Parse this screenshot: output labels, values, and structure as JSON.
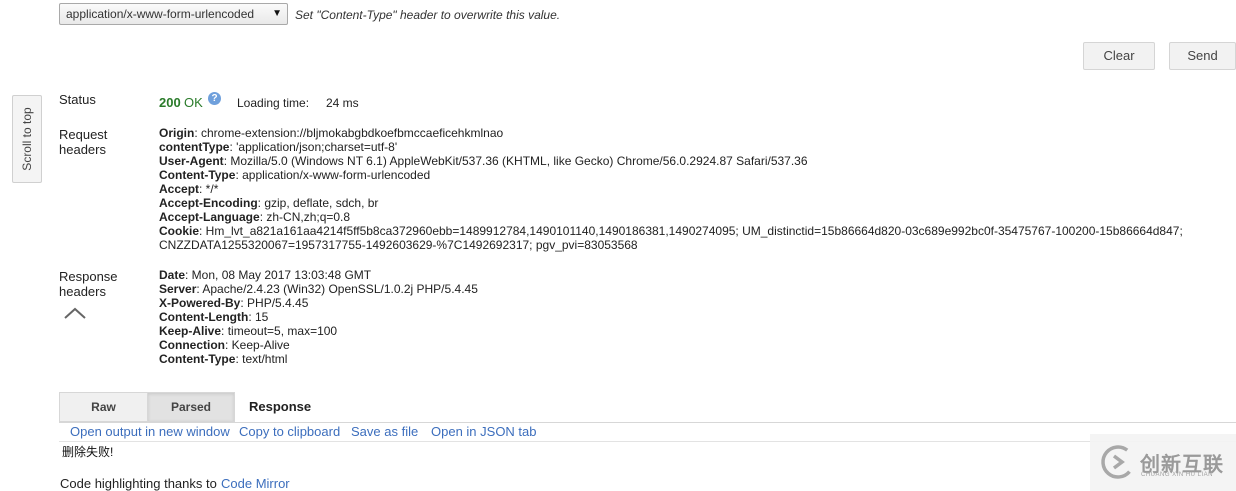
{
  "content_type": {
    "selected": "application/x-www-form-urlencoded",
    "hint": "Set \"Content-Type\" header to overwrite this value."
  },
  "actions": {
    "clear": "Clear",
    "send": "Send"
  },
  "scroll_to_top": "Scroll to top",
  "status": {
    "label": "Status",
    "code": "200",
    "text": "OK",
    "loading_label": "Loading time:",
    "loading_value": "24 ms",
    "code_color": "#2a7b2a"
  },
  "request_headers": {
    "label_line1": "Request",
    "label_line2": "headers",
    "items": [
      {
        "name": "Origin",
        "value": ": chrome-extension://bljmokabgbdkoefbmccaeficehkmlnao"
      },
      {
        "name": "contentType",
        "value": ": 'application/json;charset=utf-8'"
      },
      {
        "name": "User-Agent",
        "value": ": Mozilla/5.0 (Windows NT 6.1) AppleWebKit/537.36 (KHTML, like Gecko) Chrome/56.0.2924.87 Safari/537.36"
      },
      {
        "name": "Content-Type",
        "value": ": application/x-www-form-urlencoded"
      },
      {
        "name": "Accept",
        "value": ": */*"
      },
      {
        "name": "Accept-Encoding",
        "value": ": gzip, deflate, sdch, br"
      },
      {
        "name": "Accept-Language",
        "value": ": zh-CN,zh;q=0.8"
      },
      {
        "name": "Cookie",
        "value": ": Hm_lvt_a821a161aa4214f5ff5b8ca372960ebb=1489912784,1490101140,1490186381,1490274095; UM_distinctid=15b86664d820-03c689e992bc0f-35475767-100200-15b86664d847;"
      }
    ],
    "cookie_continuation": "CNZZDATA1255320067=1957317755-1492603629-%7C1492692317; pgv_pvi=83053568"
  },
  "response_headers": {
    "label_line1": "Response",
    "label_line2": "headers",
    "items": [
      {
        "name": "Date",
        "value": ": Mon, 08 May 2017 13:03:48 GMT"
      },
      {
        "name": "Server",
        "value": ": Apache/2.4.23 (Win32) OpenSSL/1.0.2j PHP/5.4.45"
      },
      {
        "name": "X-Powered-By",
        "value": ": PHP/5.4.45"
      },
      {
        "name": "Content-Length",
        "value": ": 15"
      },
      {
        "name": "Keep-Alive",
        "value": ": timeout=5, max=100"
      },
      {
        "name": "Connection",
        "value": ": Keep-Alive"
      },
      {
        "name": "Content-Type",
        "value": ": text/html"
      }
    ]
  },
  "tabs": {
    "raw": "Raw",
    "parsed": "Parsed",
    "response": "Response"
  },
  "response_actions": {
    "open_output": "Open output in new window",
    "copy": "Copy to clipboard",
    "save": "Save as file",
    "open_json": "Open in JSON tab"
  },
  "response_body": "删除失败!",
  "credits": {
    "text": "Code highlighting thanks to",
    "link": "Code Mirror"
  },
  "watermark": {
    "title": "创新互联",
    "subtitle": "CHUANG XIN HU LIAN"
  }
}
